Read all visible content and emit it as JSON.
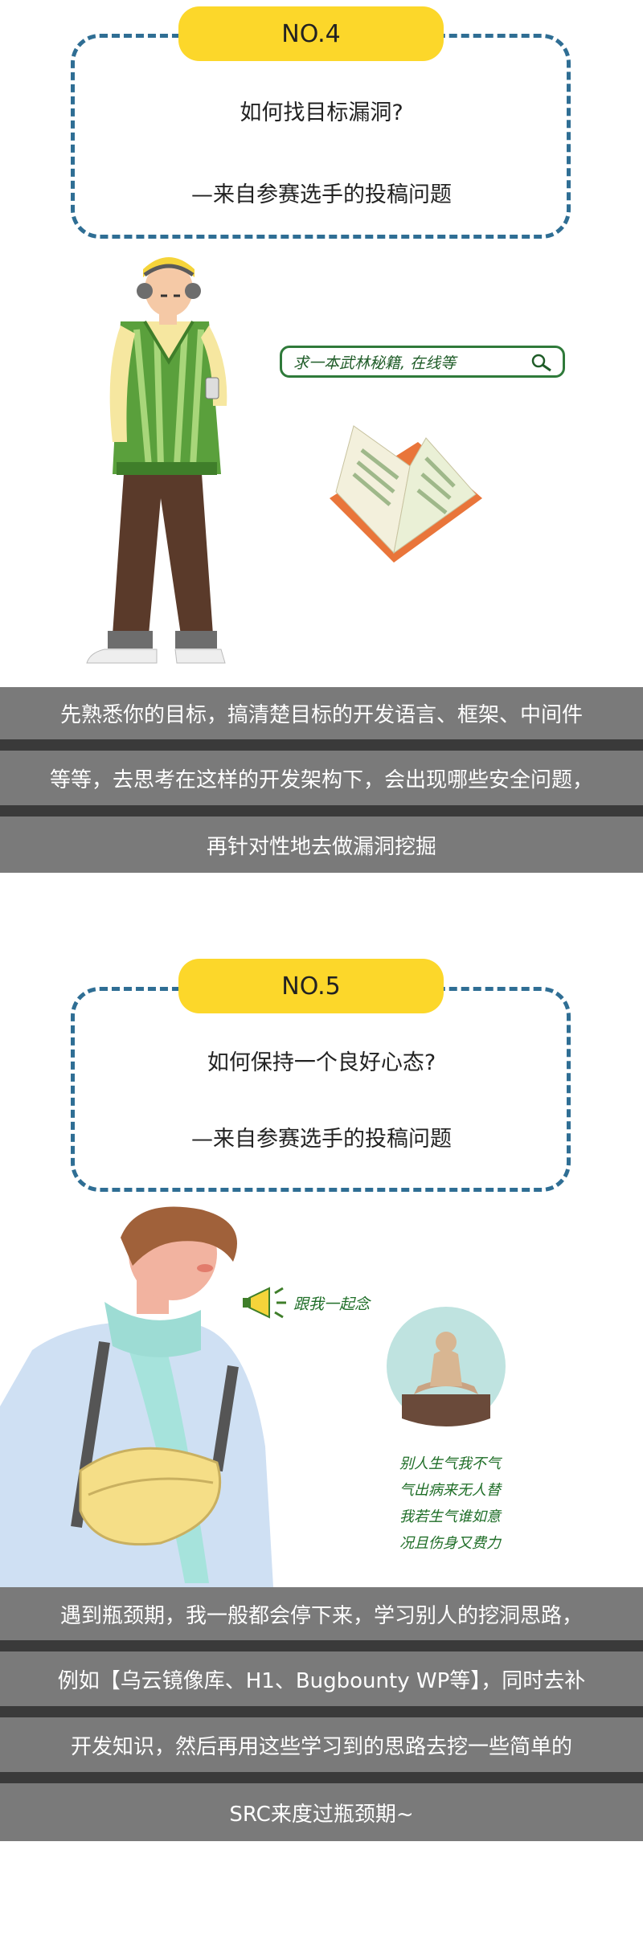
{
  "section4": {
    "tag": "NO.4",
    "question": "如何找目标漏洞?",
    "source": "—来自参赛选手的投稿问题",
    "search_text": "求一本武林秘籍, 在线等",
    "bands": [
      "先熟悉你的目标，搞清楚目标的开发语言、框架、中间件",
      "等等，去思考在这样的开发架构下，会出现哪些安全问题，",
      "再针对性地去做漏洞挖掘"
    ]
  },
  "section5": {
    "tag": "NO.5",
    "question": "如何保持一个良好心态?",
    "source": "—来自参赛选手的投稿问题",
    "cheer_text": "跟我一起念",
    "poem_lines": [
      "别人生气我不气",
      "气出病来无人替",
      "我若生气谁如意",
      "况且伤身又费力"
    ],
    "bands": [
      "遇到瓶颈期，我一般都会停下来，学习别人的挖洞思路，",
      "例如【乌云镜像库、H1、Bugbounty WP等】，同时去补",
      "开发知识，然后再用这些学习到的思路去挖一些简单的",
      "SRC来度过瓶颈期~"
    ]
  },
  "colors": {
    "accent_yellow": "#fcd72a",
    "border_blue": "#2f6e94",
    "band_gray": "#7a7a7a",
    "green_text": "#1f6e28"
  }
}
